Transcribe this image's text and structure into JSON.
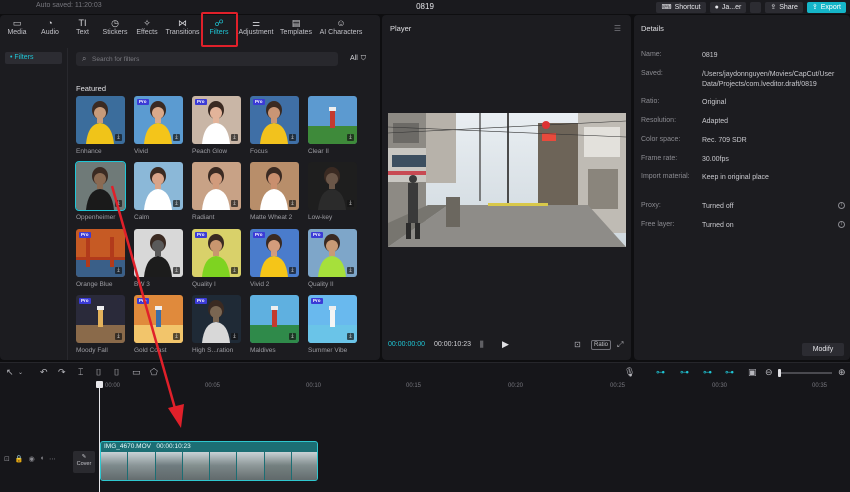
{
  "titlebar": {
    "autosave": "Auto saved: 11:20:03",
    "project_title": "0819",
    "shortcut_label": "Shortcut",
    "user_label": "Ja...er",
    "share_label": "Share",
    "export_label": "Export"
  },
  "tabs": [
    {
      "label": "Media",
      "icon": "▭"
    },
    {
      "label": "Audio",
      "icon": "◔"
    },
    {
      "label": "Text",
      "icon": "TI"
    },
    {
      "label": "Stickers",
      "icon": "◷"
    },
    {
      "label": "Effects",
      "icon": "✧"
    },
    {
      "label": "Transitions",
      "icon": "⋈"
    },
    {
      "label": "Filters",
      "icon": "☍"
    },
    {
      "label": "Adjustment",
      "icon": "⚌"
    },
    {
      "label": "Templates",
      "icon": "▤"
    },
    {
      "label": "AI Characters",
      "icon": "☺"
    }
  ],
  "active_tab": "Filters",
  "left_nav": {
    "item": "• Filters"
  },
  "search": {
    "placeholder": "Search for filters"
  },
  "all_filter": {
    "label": "All"
  },
  "section_title": "Featured",
  "filters": [
    {
      "label": "Enhance",
      "pro": false
    },
    {
      "label": "Vivid",
      "pro": true
    },
    {
      "label": "Peach Glow",
      "pro": true
    },
    {
      "label": "Focus",
      "pro": true
    },
    {
      "label": "Clear II",
      "pro": false
    },
    {
      "label": "Oppenheimer",
      "pro": false
    },
    {
      "label": "Calm",
      "pro": false
    },
    {
      "label": "Radiant",
      "pro": false
    },
    {
      "label": "Matte Wheat 2",
      "pro": false
    },
    {
      "label": "Low-key",
      "pro": false
    },
    {
      "label": "Orange Blue",
      "pro": true
    },
    {
      "label": "BW 3",
      "pro": false
    },
    {
      "label": "Quality I",
      "pro": true
    },
    {
      "label": "Vivid 2",
      "pro": true
    },
    {
      "label": "Quality II",
      "pro": true
    },
    {
      "label": "Moody Fall",
      "pro": true
    },
    {
      "label": "Gold Coast",
      "pro": true
    },
    {
      "label": "High S...ration",
      "pro": true
    },
    {
      "label": "Maldives",
      "pro": false
    },
    {
      "label": "Summer Vibe",
      "pro": true
    }
  ],
  "pro_badge": "Pro",
  "player": {
    "title": "Player",
    "current_time": "00:00:00:00",
    "duration": "00:00:10:23",
    "ratio_label": "Ratio"
  },
  "details": {
    "title": "Details",
    "rows": [
      {
        "key": "Name:",
        "value": "0819"
      },
      {
        "key": "Saved:",
        "value": "/Users/jaydonnguyen/Movies/CapCut/User Data/Projects/com.lveditor.draft/0819"
      },
      {
        "key": "Ratio:",
        "value": "Original"
      },
      {
        "key": "Resolution:",
        "value": "Adapted"
      },
      {
        "key": "Color space:",
        "value": "Rec. 709 SDR"
      },
      {
        "key": "Frame rate:",
        "value": "30.00fps"
      },
      {
        "key": "Import material:",
        "value": "Keep in original place"
      },
      {
        "key": "Proxy:",
        "value": "Turned off"
      },
      {
        "key": "Free layer:",
        "value": "Turned on"
      }
    ],
    "modify_label": "Modify"
  },
  "timeline": {
    "ticks": [
      "00:00",
      "00:05",
      "00:10",
      "00:15",
      "00:20",
      "00:25",
      "00:30",
      "00:35"
    ],
    "cover_label": "Cover",
    "clip_name": "IMG_4670.MOV",
    "clip_duration": "00:00:10:23"
  },
  "colors": {
    "accent": "#1fc6d6",
    "highlight": "#e0202a",
    "export": "#15b5c8"
  }
}
